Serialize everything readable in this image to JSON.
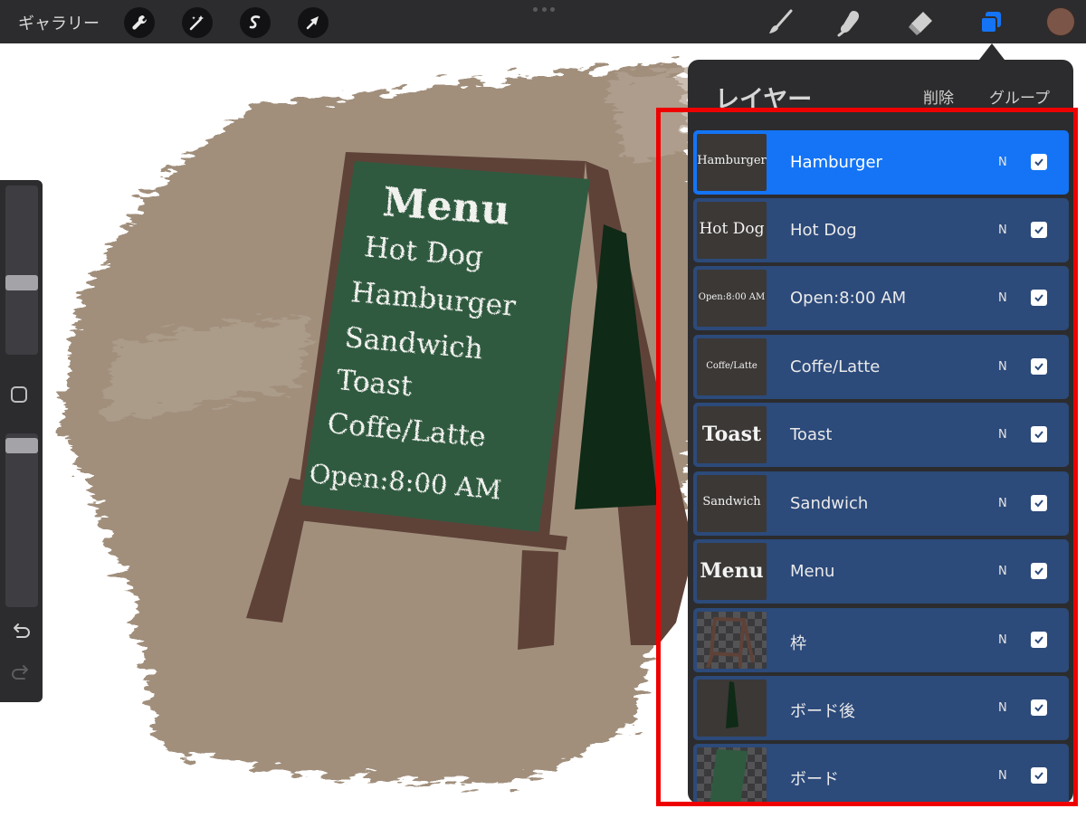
{
  "toolbar": {
    "gallery_label": "ギャラリー",
    "left_tools": [
      "wrench-icon",
      "magic-wand-icon",
      "selection-icon",
      "transform-arrow-icon"
    ],
    "right_tools": [
      "brush-icon",
      "smudge-icon",
      "eraser-icon",
      "layers-icon"
    ],
    "current_color": "#7a5548",
    "active_accent": "#1474f5"
  },
  "sidebar": {
    "brush_size_level": 0.42,
    "opacity_level": 0.97
  },
  "layers_panel": {
    "title": "レイヤー",
    "delete_label": "削除",
    "group_label": "グループ",
    "layers": [
      {
        "name": "Hamburger",
        "thumb": "Hamburger",
        "blend": "N",
        "visible": true,
        "selected": true
      },
      {
        "name": "Hot Dog",
        "thumb": "Hot Dog",
        "blend": "N",
        "visible": true
      },
      {
        "name": "Open:8:00 AM",
        "thumb": "Open:8:00 AM",
        "blend": "N",
        "visible": true
      },
      {
        "name": "Coffe/Latte",
        "thumb": "Coffe/Latte",
        "blend": "N",
        "visible": true
      },
      {
        "name": "Toast",
        "thumb": "Toast",
        "blend": "N",
        "visible": true
      },
      {
        "name": "Sandwich",
        "thumb": "Sandwich",
        "blend": "N",
        "visible": true
      },
      {
        "name": "Menu",
        "thumb": "Menu",
        "blend": "N",
        "visible": true
      },
      {
        "name": "枠",
        "blend": "N",
        "visible": true
      },
      {
        "name": "ボード後",
        "blend": "N",
        "visible": true
      },
      {
        "name": "ボード",
        "blend": "N",
        "visible": true
      }
    ]
  },
  "artwork": {
    "title": "Menu",
    "lines": [
      "Hot Dog",
      "Hamburger",
      "Sandwich",
      "Toast",
      "Coffe/Latte",
      "Open:8:00 AM"
    ],
    "background_color": "#a18f7c",
    "board_color": "#2f5a3f",
    "frame_color": "#5e4238"
  }
}
